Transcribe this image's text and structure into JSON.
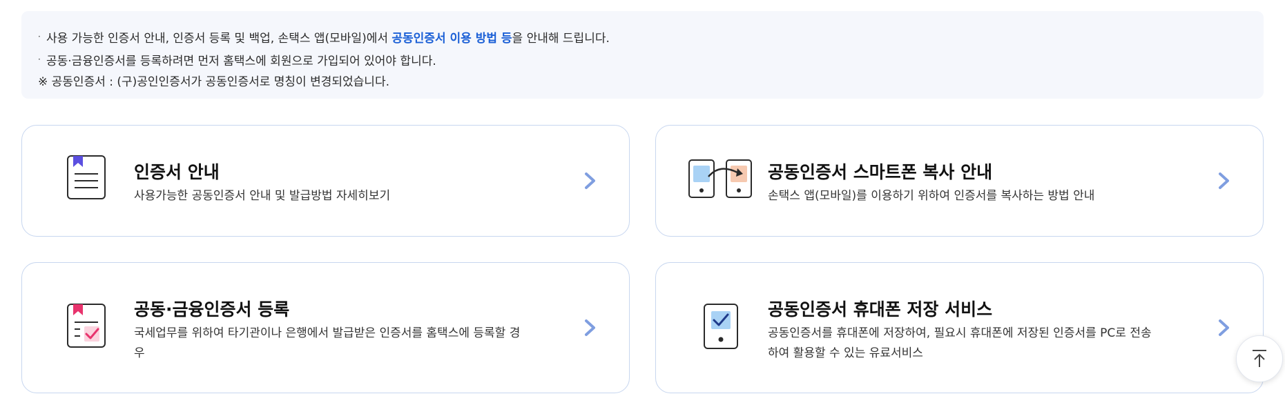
{
  "notice": {
    "line1_pre": "사용 가능한 인증서 안내, 인증서 등록 및 백업, 손택스 앱(모바일)에서 ",
    "line1_highlight": "공동인증서 이용 방법 등",
    "line1_post": "을 안내해 드립니다.",
    "line2": "공동·금융인증서를 등록하려면 먼저 홈택스에 회원으로 가입되어 있어야 합니다.",
    "line3": "※ 공동인증서 : (구)공인인증서가 공동인증서로 명칭이 변경되었습니다."
  },
  "cards": [
    {
      "title": "인증서 안내",
      "desc": "사용가능한 공동인증서 안내 및 발급방법 자세히보기",
      "icon": "document-bookmark-icon"
    },
    {
      "title": "공동인증서 스마트폰 복사 안내",
      "desc": "손택스 앱(모바일)를 이용하기 위하여 인증서를 복사하는 방법 안내",
      "icon": "phone-copy-icon"
    },
    {
      "title": "공동·금융인증서 등록",
      "desc": "국세업무를 위하여 타기관이나 은행에서 발급받은 인증서를 홈택스에 등록할 경우",
      "icon": "document-check-icon"
    },
    {
      "title": "공동인증서 휴대폰 저장 서비스",
      "desc": "공동인증서를 휴대폰에 저장하여, 필요시 휴대폰에 저장된 인증서를 PC로 전송하여 활용할 수 있는 유료서비스",
      "icon": "phone-check-icon"
    }
  ],
  "colors": {
    "highlight": "#1a5fd6",
    "arrow": "#7f9ee0",
    "card_border": "#c7d6ef",
    "bookmark_blue": "#5b4fe0",
    "bookmark_pink": "#e8336d"
  },
  "scroll_top_icon": "arrow-up-icon"
}
